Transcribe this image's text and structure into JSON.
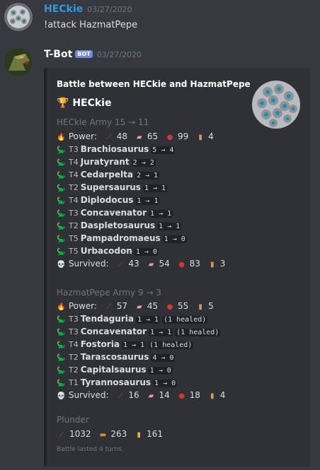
{
  "messages": [
    {
      "author": "HECkie",
      "author_color": "#3498db",
      "timestamp": "03/27/2020",
      "text": "!attack HazmatPepe"
    },
    {
      "author": "T-Bot",
      "author_color": "#ffffff",
      "bot_tag": "BOT",
      "timestamp": "03/27/2020"
    }
  ],
  "embed": {
    "title": "Battle between HECkie and HazmatPepe",
    "winner_icon": "🏆",
    "winner": "HECkie",
    "armies": [
      {
        "header": "HECkie Army 15 → 11",
        "power_label": "Power:",
        "power": [
          "48",
          "65",
          "99",
          "4"
        ],
        "dinos": [
          {
            "tier": "T3",
            "name": "Brachiosaurus",
            "change": "5 → 4",
            "note": ""
          },
          {
            "tier": "T4",
            "name": "Juratyrant",
            "change": "2 → 2",
            "note": ""
          },
          {
            "tier": "T4",
            "name": "Cedarpelta",
            "change": "2 → 1",
            "note": ""
          },
          {
            "tier": "T2",
            "name": "Supersaurus",
            "change": "1 → 1",
            "note": ""
          },
          {
            "tier": "T4",
            "name": "Diplodocus",
            "change": "1 → 1",
            "note": ""
          },
          {
            "tier": "T3",
            "name": "Concavenator",
            "change": "1 → 1",
            "note": ""
          },
          {
            "tier": "T2",
            "name": "Daspletosaurus",
            "change": "1 → 1",
            "note": ""
          },
          {
            "tier": "T5",
            "name": "Pampadromaeus",
            "change": "1 → 0",
            "note": ""
          },
          {
            "tier": "T5",
            "name": "Urbacodon",
            "change": "1 → 0",
            "note": ""
          }
        ],
        "survived_label": "Survived:",
        "survived": [
          "43",
          "54",
          "83",
          "3"
        ]
      },
      {
        "header": "HazmatPepe Army 9 → 3",
        "power_label": "Power:",
        "power": [
          "57",
          "45",
          "55",
          "5"
        ],
        "dinos": [
          {
            "tier": "T3",
            "name": "Tendaguria",
            "change": "1 → 1",
            "note": "(1 healed)"
          },
          {
            "tier": "T3",
            "name": "Concavenator",
            "change": "1 → 1",
            "note": "(1 healed)"
          },
          {
            "tier": "T4",
            "name": "Fostoria",
            "change": "1 → 1",
            "note": "(1 healed)"
          },
          {
            "tier": "T2",
            "name": "Tarascosaurus",
            "change": "4 → 0",
            "note": ""
          },
          {
            "tier": "T2",
            "name": "Capitalsaurus",
            "change": "1 → 0",
            "note": ""
          },
          {
            "tier": "T1",
            "name": "Tyrannosaurus",
            "change": "1 → 0",
            "note": ""
          }
        ],
        "survived_label": "Survived:",
        "survived": [
          "16",
          "14",
          "18",
          "4"
        ]
      }
    ],
    "plunder_label": "Plunder",
    "plunder": [
      "1032",
      "263",
      "161"
    ],
    "footer": "Battle lasted 4 turns."
  },
  "icons": {
    "fire": "fire-icon",
    "skull": "skull-icon",
    "dino": "dinosaur-icon",
    "stats": [
      "claw-icon",
      "steak-icon",
      "blood-icon",
      "bone-icon"
    ],
    "plunder": [
      "claw-icon",
      "wood-icon",
      "gold-icon"
    ]
  }
}
